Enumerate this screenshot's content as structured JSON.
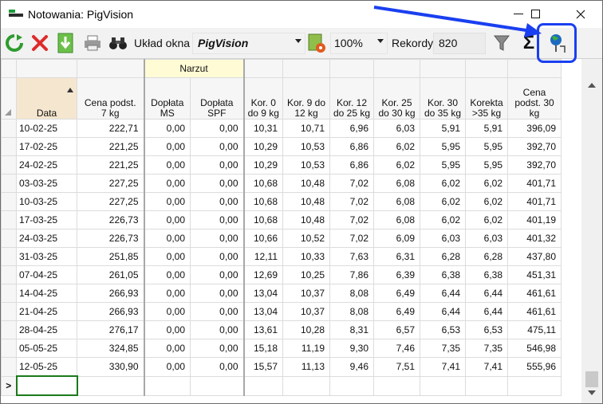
{
  "window": {
    "title": "Notowania: PigVision",
    "minimize_glyph": "—",
    "maximize_glyph": "☐",
    "close_glyph": "✕"
  },
  "toolbar": {
    "layout_label": "Układ okna",
    "layout_value": "PigVision",
    "zoom_value": "100%",
    "records_label": "Rekordy",
    "records_value": "820",
    "sum_glyph": "Σ",
    "icons": [
      "refresh-icon",
      "delete-icon",
      "download-icon",
      "print-icon",
      "binoculars-icon",
      "layout-settings-icon",
      "filter-icon",
      "sum-icon",
      "pin-user-icon"
    ]
  },
  "grid": {
    "group_header": "Narzut",
    "headers": {
      "date": "Data",
      "c1": [
        "Cena podst.",
        "7 kg"
      ],
      "c2": [
        "Dopłata",
        "MS"
      ],
      "c3": [
        "Dopłata",
        "SPF"
      ],
      "c4": [
        "Kor. 0",
        "do 9 kg"
      ],
      "c5": [
        "Kor. 9 do",
        "12 kg"
      ],
      "c6": [
        "Kor. 12",
        "do 25 kg"
      ],
      "c7": [
        "Kor. 25",
        "do 30 kg"
      ],
      "c8": [
        "Kor. 30",
        "do 35 kg"
      ],
      "c9": [
        "Korekta",
        ">35 kg"
      ],
      "c10": [
        "Cena",
        "podst. 30",
        "kg"
      ]
    },
    "rows": [
      [
        "10-02-25",
        "222,71",
        "0,00",
        "0,00",
        "10,31",
        "10,71",
        "6,96",
        "6,03",
        "5,91",
        "5,91",
        "396,09"
      ],
      [
        "17-02-25",
        "221,25",
        "0,00",
        "0,00",
        "10,29",
        "10,53",
        "6,86",
        "6,02",
        "5,95",
        "5,95",
        "392,70"
      ],
      [
        "24-02-25",
        "221,25",
        "0,00",
        "0,00",
        "10,29",
        "10,53",
        "6,86",
        "6,02",
        "5,95",
        "5,95",
        "392,70"
      ],
      [
        "03-03-25",
        "227,25",
        "0,00",
        "0,00",
        "10,68",
        "10,48",
        "7,02",
        "6,08",
        "6,02",
        "6,02",
        "401,71"
      ],
      [
        "10-03-25",
        "227,25",
        "0,00",
        "0,00",
        "10,68",
        "10,48",
        "7,02",
        "6,08",
        "6,02",
        "6,02",
        "401,71"
      ],
      [
        "17-03-25",
        "226,73",
        "0,00",
        "0,00",
        "10,68",
        "10,48",
        "7,02",
        "6,08",
        "6,02",
        "6,02",
        "401,19"
      ],
      [
        "24-03-25",
        "226,73",
        "0,00",
        "0,00",
        "10,66",
        "10,52",
        "7,02",
        "6,09",
        "6,03",
        "6,03",
        "401,32"
      ],
      [
        "31-03-25",
        "251,85",
        "0,00",
        "0,00",
        "12,11",
        "10,33",
        "7,63",
        "6,31",
        "6,28",
        "6,28",
        "437,80"
      ],
      [
        "07-04-25",
        "261,05",
        "0,00",
        "0,00",
        "12,69",
        "10,25",
        "7,86",
        "6,39",
        "6,38",
        "6,38",
        "451,31"
      ],
      [
        "14-04-25",
        "266,93",
        "0,00",
        "0,00",
        "13,04",
        "10,37",
        "8,08",
        "6,49",
        "6,44",
        "6,44",
        "461,61"
      ],
      [
        "21-04-25",
        "266,93",
        "0,00",
        "0,00",
        "13,04",
        "10,37",
        "8,08",
        "6,49",
        "6,44",
        "6,44",
        "461,61"
      ],
      [
        "28-04-25",
        "276,17",
        "0,00",
        "0,00",
        "13,61",
        "10,28",
        "8,31",
        "6,57",
        "6,53",
        "6,53",
        "475,11"
      ],
      [
        "05-05-25",
        "324,85",
        "0,00",
        "0,00",
        "15,18",
        "11,19",
        "9,30",
        "7,46",
        "7,35",
        "7,35",
        "546,98"
      ],
      [
        "12-05-25",
        "330,90",
        "0,00",
        "0,00",
        "15,57",
        "11,13",
        "9,46",
        "7,51",
        "7,41",
        "7,41",
        "555,96"
      ]
    ],
    "new_row_indicator": ">"
  },
  "colors": {
    "highlight": "#1a3ff0",
    "group_header_bg": "#fffbd5",
    "sorted_header_bg": "#f5e6cf"
  }
}
